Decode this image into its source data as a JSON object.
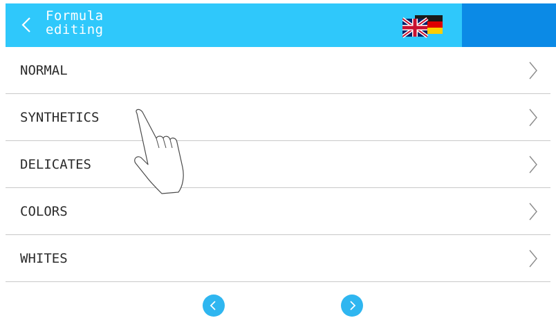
{
  "header": {
    "title_line1": "Formula",
    "title_line2": "editing",
    "back_icon": "chevron-left-icon",
    "language_icon": "uk-german-flag-icon"
  },
  "list": {
    "items": [
      {
        "label": "NORMAL"
      },
      {
        "label": "SYNTHETICS"
      },
      {
        "label": "DELICATES"
      },
      {
        "label": "COLORS"
      },
      {
        "label": "WHITES"
      }
    ]
  },
  "pagination": {
    "prev_icon": "chevron-left-icon",
    "next_icon": "chevron-right-icon"
  },
  "colors": {
    "header": "#2fc8fb",
    "header_accent": "#0b8ae6",
    "nav_button": "#2fb6f0",
    "divider": "#c8c8c8"
  }
}
